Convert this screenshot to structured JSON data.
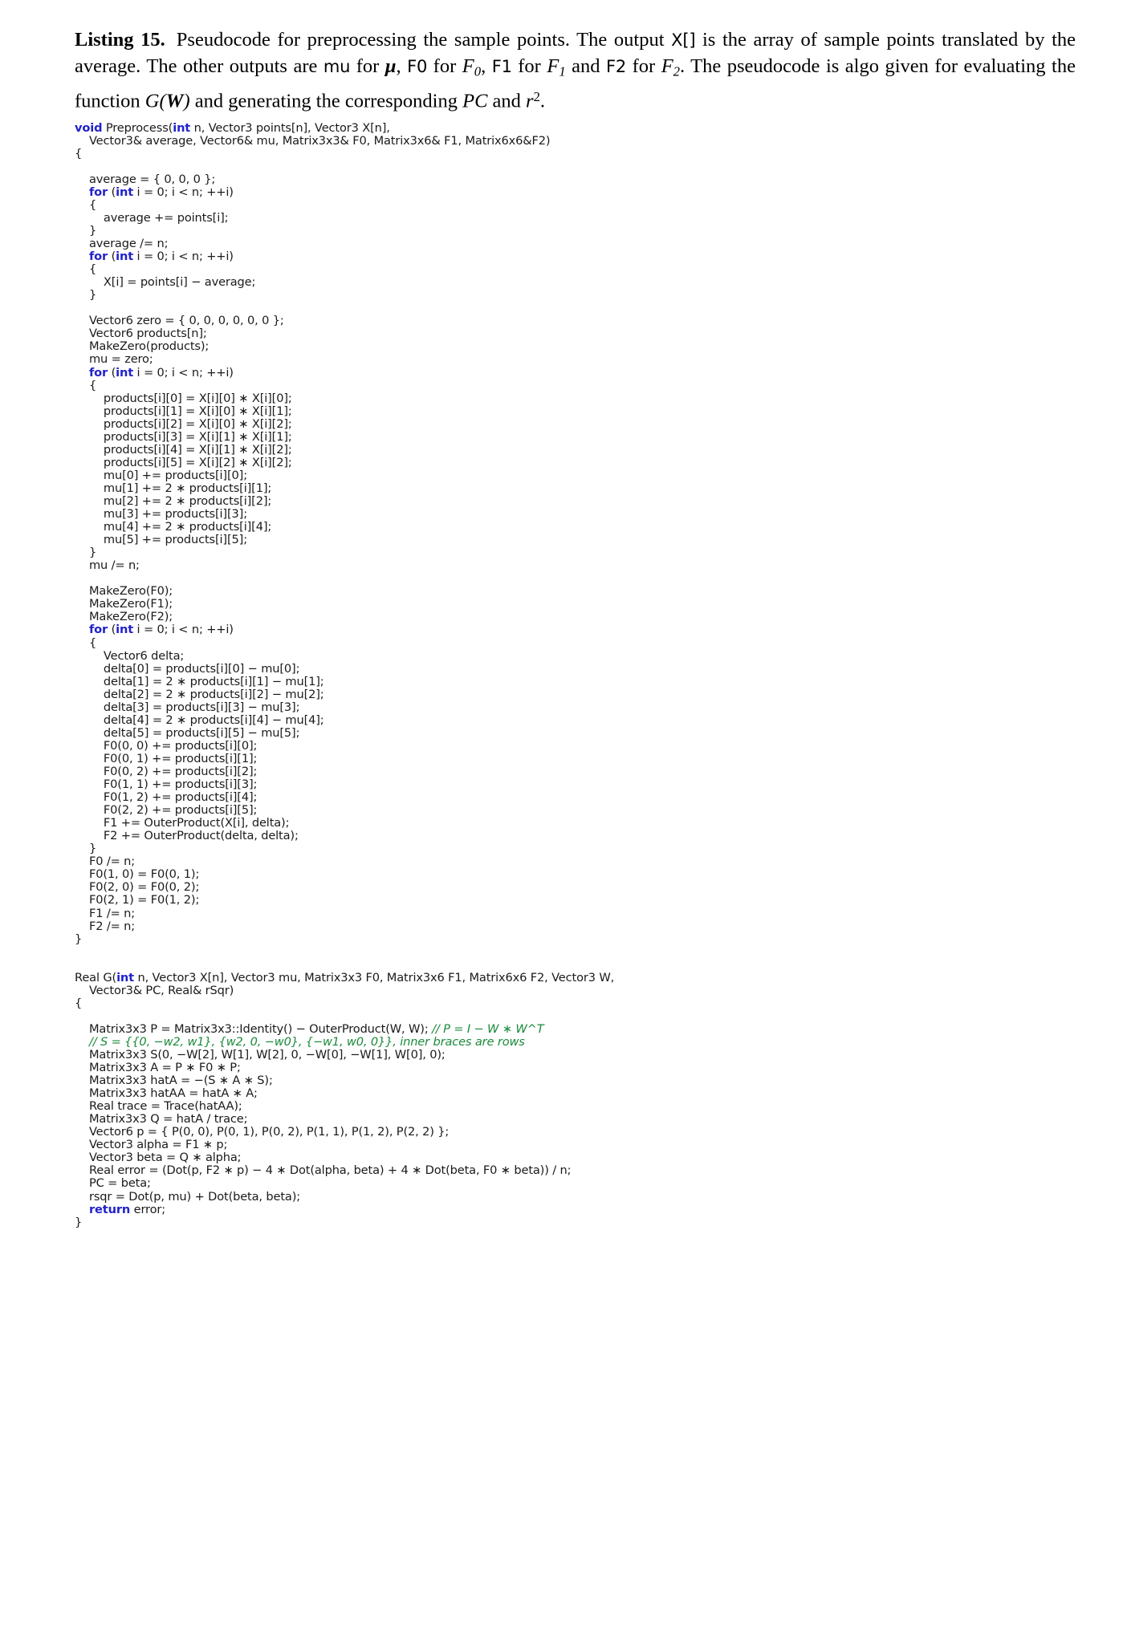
{
  "caption": {
    "label": "Listing 15.",
    "part1": "Pseudocode for preprocessing the sample points.  The output ",
    "code1": "X[]",
    "part2": " is the array of sample points translated by the average. The other outputs are ",
    "code2": "mu",
    "part3": " for ",
    "math1": "μ",
    "part4": ", ",
    "code3": "F0",
    "part5": " for ",
    "math2": "F",
    "math2sub": "0",
    "part6": ", ",
    "code4": "F1",
    "part7": " for ",
    "math3": "F",
    "math3sub": "1",
    "part8": " and ",
    "code5": "F2",
    "part9": " for ",
    "math4": "F",
    "math4sub": "2",
    "part10": ". The pseudocode is algo given for evaluating the function ",
    "math5": "G",
    "math5open": "(",
    "math5arg": "W",
    "math5close": ")",
    "part11": " and generating the corresponding ",
    "math6": "PC",
    "part12": " and ",
    "math7": "r",
    "math7sup": "2",
    "part13": "."
  },
  "colors": {
    "keyword": "#2222cc",
    "comment": "#1a8a3a",
    "text": "#1a1a1a",
    "background": "#ffffff"
  },
  "code": {
    "language": "C++",
    "keywords": [
      "void",
      "int",
      "for",
      "return"
    ],
    "lines": [
      {
        "indent": 0,
        "segments": [
          {
            "t": "void",
            "k": "kw"
          },
          {
            "t": " Preprocess("
          },
          {
            "t": "int",
            "k": "kw"
          },
          {
            "t": " n, Vector3 points[n], Vector3 X[n],"
          }
        ]
      },
      {
        "indent": 1,
        "segments": [
          {
            "t": "Vector3& average, Vector6& mu, Matrix3x3& F0, Matrix3x6& F1, Matrix6x6&F2)"
          }
        ]
      },
      {
        "indent": 0,
        "segments": [
          {
            "t": "{"
          }
        ]
      },
      {
        "indent": 0,
        "segments": [
          {
            "t": ""
          }
        ]
      },
      {
        "indent": 1,
        "segments": [
          {
            "t": "average = { 0, 0, 0 };"
          }
        ]
      },
      {
        "indent": 1,
        "segments": [
          {
            "t": "for",
            "k": "kw"
          },
          {
            "t": " ("
          },
          {
            "t": "int",
            "k": "kw"
          },
          {
            "t": " i = 0; i < n; ++i)"
          }
        ]
      },
      {
        "indent": 1,
        "segments": [
          {
            "t": "{"
          }
        ]
      },
      {
        "indent": 2,
        "segments": [
          {
            "t": "average += points[i];"
          }
        ]
      },
      {
        "indent": 1,
        "segments": [
          {
            "t": "}"
          }
        ]
      },
      {
        "indent": 1,
        "segments": [
          {
            "t": "average /= n;"
          }
        ]
      },
      {
        "indent": 1,
        "segments": [
          {
            "t": "for",
            "k": "kw"
          },
          {
            "t": " ("
          },
          {
            "t": "int",
            "k": "kw"
          },
          {
            "t": " i = 0; i < n; ++i)"
          }
        ]
      },
      {
        "indent": 1,
        "segments": [
          {
            "t": "{"
          }
        ]
      },
      {
        "indent": 2,
        "segments": [
          {
            "t": "X[i] = points[i] − average;"
          }
        ]
      },
      {
        "indent": 1,
        "segments": [
          {
            "t": "}"
          }
        ]
      },
      {
        "indent": 0,
        "segments": [
          {
            "t": ""
          }
        ]
      },
      {
        "indent": 1,
        "segments": [
          {
            "t": "Vector6 zero = { 0, 0, 0, 0, 0, 0 };"
          }
        ]
      },
      {
        "indent": 1,
        "segments": [
          {
            "t": "Vector6 products[n];"
          }
        ]
      },
      {
        "indent": 1,
        "segments": [
          {
            "t": "MakeZero(products);"
          }
        ]
      },
      {
        "indent": 1,
        "segments": [
          {
            "t": "mu = zero;"
          }
        ]
      },
      {
        "indent": 1,
        "segments": [
          {
            "t": "for",
            "k": "kw"
          },
          {
            "t": " ("
          },
          {
            "t": "int",
            "k": "kw"
          },
          {
            "t": " i = 0; i < n; ++i)"
          }
        ]
      },
      {
        "indent": 1,
        "segments": [
          {
            "t": "{"
          }
        ]
      },
      {
        "indent": 2,
        "segments": [
          {
            "t": "products[i][0] = X[i][0] ∗ X[i][0];"
          }
        ]
      },
      {
        "indent": 2,
        "segments": [
          {
            "t": "products[i][1] = X[i][0] ∗ X[i][1];"
          }
        ]
      },
      {
        "indent": 2,
        "segments": [
          {
            "t": "products[i][2] = X[i][0] ∗ X[i][2];"
          }
        ]
      },
      {
        "indent": 2,
        "segments": [
          {
            "t": "products[i][3] = X[i][1] ∗ X[i][1];"
          }
        ]
      },
      {
        "indent": 2,
        "segments": [
          {
            "t": "products[i][4] = X[i][1] ∗ X[i][2];"
          }
        ]
      },
      {
        "indent": 2,
        "segments": [
          {
            "t": "products[i][5] = X[i][2] ∗ X[i][2];"
          }
        ]
      },
      {
        "indent": 2,
        "segments": [
          {
            "t": "mu[0] += products[i][0];"
          }
        ]
      },
      {
        "indent": 2,
        "segments": [
          {
            "t": "mu[1] += 2 ∗ products[i][1];"
          }
        ]
      },
      {
        "indent": 2,
        "segments": [
          {
            "t": "mu[2] += 2 ∗ products[i][2];"
          }
        ]
      },
      {
        "indent": 2,
        "segments": [
          {
            "t": "mu[3] += products[i][3];"
          }
        ]
      },
      {
        "indent": 2,
        "segments": [
          {
            "t": "mu[4] += 2 ∗ products[i][4];"
          }
        ]
      },
      {
        "indent": 2,
        "segments": [
          {
            "t": "mu[5] += products[i][5];"
          }
        ]
      },
      {
        "indent": 1,
        "segments": [
          {
            "t": "}"
          }
        ]
      },
      {
        "indent": 1,
        "segments": [
          {
            "t": "mu /= n;"
          }
        ]
      },
      {
        "indent": 0,
        "segments": [
          {
            "t": ""
          }
        ]
      },
      {
        "indent": 1,
        "segments": [
          {
            "t": "MakeZero(F0);"
          }
        ]
      },
      {
        "indent": 1,
        "segments": [
          {
            "t": "MakeZero(F1);"
          }
        ]
      },
      {
        "indent": 1,
        "segments": [
          {
            "t": "MakeZero(F2);"
          }
        ]
      },
      {
        "indent": 1,
        "segments": [
          {
            "t": "for",
            "k": "kw"
          },
          {
            "t": " ("
          },
          {
            "t": "int",
            "k": "kw"
          },
          {
            "t": " i = 0; i < n; ++i)"
          }
        ]
      },
      {
        "indent": 1,
        "segments": [
          {
            "t": "{"
          }
        ]
      },
      {
        "indent": 2,
        "segments": [
          {
            "t": "Vector6 delta;"
          }
        ]
      },
      {
        "indent": 2,
        "segments": [
          {
            "t": "delta[0] = products[i][0] − mu[0];"
          }
        ]
      },
      {
        "indent": 2,
        "segments": [
          {
            "t": "delta[1] = 2 ∗ products[i][1] − mu[1];"
          }
        ]
      },
      {
        "indent": 2,
        "segments": [
          {
            "t": "delta[2] = 2 ∗ products[i][2] − mu[2];"
          }
        ]
      },
      {
        "indent": 2,
        "segments": [
          {
            "t": "delta[3] = products[i][3] − mu[3];"
          }
        ]
      },
      {
        "indent": 2,
        "segments": [
          {
            "t": "delta[4] = 2 ∗ products[i][4] − mu[4];"
          }
        ]
      },
      {
        "indent": 2,
        "segments": [
          {
            "t": "delta[5] = products[i][5] − mu[5];"
          }
        ]
      },
      {
        "indent": 2,
        "segments": [
          {
            "t": "F0(0, 0) += products[i][0];"
          }
        ]
      },
      {
        "indent": 2,
        "segments": [
          {
            "t": "F0(0, 1) += products[i][1];"
          }
        ]
      },
      {
        "indent": 2,
        "segments": [
          {
            "t": "F0(0, 2) += products[i][2];"
          }
        ]
      },
      {
        "indent": 2,
        "segments": [
          {
            "t": "F0(1, 1) += products[i][3];"
          }
        ]
      },
      {
        "indent": 2,
        "segments": [
          {
            "t": "F0(1, 2) += products[i][4];"
          }
        ]
      },
      {
        "indent": 2,
        "segments": [
          {
            "t": "F0(2, 2) += products[i][5];"
          }
        ]
      },
      {
        "indent": 2,
        "segments": [
          {
            "t": "F1 += OuterProduct(X[i], delta);"
          }
        ]
      },
      {
        "indent": 2,
        "segments": [
          {
            "t": "F2 += OuterProduct(delta, delta);"
          }
        ]
      },
      {
        "indent": 1,
        "segments": [
          {
            "t": "}"
          }
        ]
      },
      {
        "indent": 1,
        "segments": [
          {
            "t": "F0 /= n;"
          }
        ]
      },
      {
        "indent": 1,
        "segments": [
          {
            "t": "F0(1, 0) = F0(0, 1);"
          }
        ]
      },
      {
        "indent": 1,
        "segments": [
          {
            "t": "F0(2, 0) = F0(0, 2);"
          }
        ]
      },
      {
        "indent": 1,
        "segments": [
          {
            "t": "F0(2, 1) = F0(1, 2);"
          }
        ]
      },
      {
        "indent": 1,
        "segments": [
          {
            "t": "F1 /= n;"
          }
        ]
      },
      {
        "indent": 1,
        "segments": [
          {
            "t": "F2 /= n;"
          }
        ]
      },
      {
        "indent": 0,
        "segments": [
          {
            "t": "}"
          }
        ]
      },
      {
        "indent": 0,
        "segments": [
          {
            "t": ""
          }
        ]
      },
      {
        "indent": 0,
        "segments": [
          {
            "t": ""
          }
        ]
      },
      {
        "indent": 0,
        "segments": [
          {
            "t": "Real G("
          },
          {
            "t": "int",
            "k": "kw"
          },
          {
            "t": " n, Vector3 X[n], Vector3 mu, Matrix3x3 F0, Matrix3x6 F1, Matrix6x6 F2, Vector3 W,"
          }
        ]
      },
      {
        "indent": 1,
        "segments": [
          {
            "t": "Vector3& PC, Real& rSqr)"
          }
        ]
      },
      {
        "indent": 0,
        "segments": [
          {
            "t": "{"
          }
        ]
      },
      {
        "indent": 0,
        "segments": [
          {
            "t": ""
          }
        ]
      },
      {
        "indent": 1,
        "segments": [
          {
            "t": "Matrix3x3 P = Matrix3x3::Identity() − OuterProduct(W, W); "
          },
          {
            "t": "// P = I − W ∗ W^T",
            "k": "cmt"
          }
        ]
      },
      {
        "indent": 1,
        "segments": [
          {
            "t": "// S = {{0, −w2, w1}, {w2, 0, −w0}, {−w1, w0, 0}}, inner braces are rows",
            "k": "cmt"
          }
        ]
      },
      {
        "indent": 1,
        "segments": [
          {
            "t": "Matrix3x3 S(0, −W[2], W[1], W[2], 0, −W[0], −W[1], W[0], 0);"
          }
        ]
      },
      {
        "indent": 1,
        "segments": [
          {
            "t": "Matrix3x3 A = P ∗ F0 ∗ P;"
          }
        ]
      },
      {
        "indent": 1,
        "segments": [
          {
            "t": "Matrix3x3 hatA = −(S ∗ A ∗ S);"
          }
        ]
      },
      {
        "indent": 1,
        "segments": [
          {
            "t": "Matrix3x3 hatAA = hatA ∗ A;"
          }
        ]
      },
      {
        "indent": 1,
        "segments": [
          {
            "t": "Real trace = Trace(hatAA);"
          }
        ]
      },
      {
        "indent": 1,
        "segments": [
          {
            "t": "Matrix3x3 Q = hatA / trace;"
          }
        ]
      },
      {
        "indent": 1,
        "segments": [
          {
            "t": "Vector6 p = { P(0, 0), P(0, 1), P(0, 2), P(1, 1), P(1, 2), P(2, 2) };"
          }
        ]
      },
      {
        "indent": 1,
        "segments": [
          {
            "t": "Vector3 alpha = F1 ∗ p;"
          }
        ]
      },
      {
        "indent": 1,
        "segments": [
          {
            "t": "Vector3 beta = Q ∗ alpha;"
          }
        ]
      },
      {
        "indent": 1,
        "segments": [
          {
            "t": "Real error = (Dot(p, F2 ∗ p) − 4 ∗ Dot(alpha, beta) + 4 ∗ Dot(beta, F0 ∗ beta)) / n;"
          }
        ]
      },
      {
        "indent": 1,
        "segments": [
          {
            "t": "PC = beta;"
          }
        ]
      },
      {
        "indent": 1,
        "segments": [
          {
            "t": "rsqr = Dot(p, mu) + Dot(beta, beta);"
          }
        ]
      },
      {
        "indent": 1,
        "segments": [
          {
            "t": "return",
            "k": "kw"
          },
          {
            "t": " error;"
          }
        ]
      },
      {
        "indent": 0,
        "segments": [
          {
            "t": "}"
          }
        ]
      }
    ]
  }
}
